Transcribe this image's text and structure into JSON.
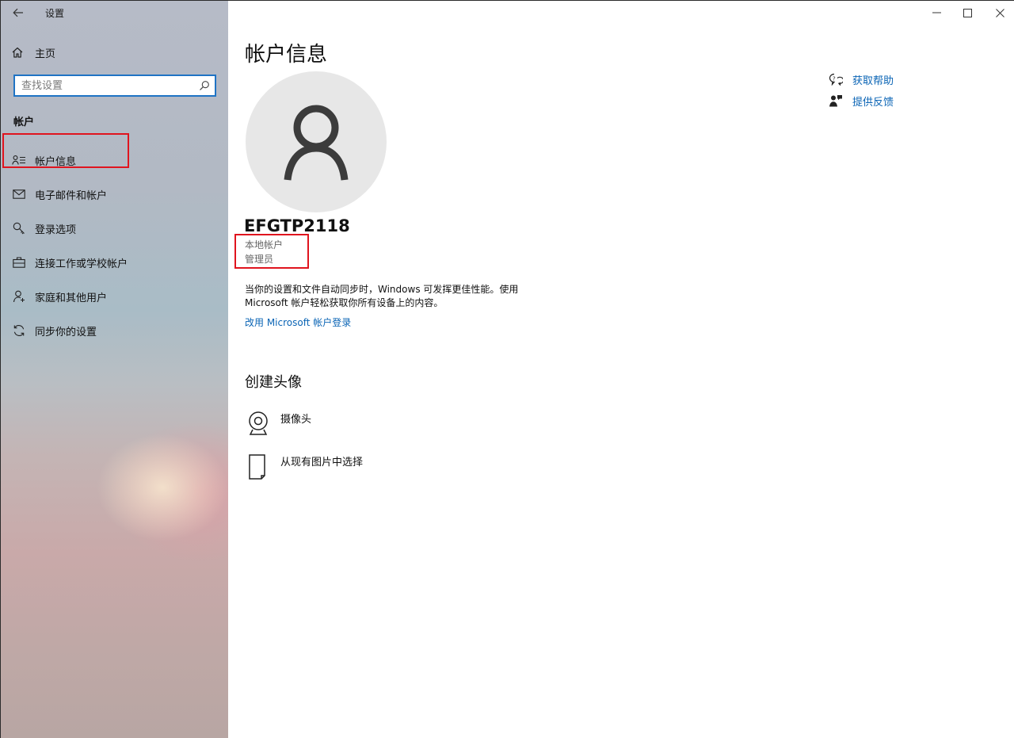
{
  "window": {
    "app_title": "设置",
    "controls": {
      "minimize": "—",
      "maximize": "☐",
      "close": "✕"
    }
  },
  "sidebar": {
    "home_label": "主页",
    "search_placeholder": "查找设置",
    "section_title": "帐户",
    "items": [
      {
        "label": "帐户信息",
        "icon": "account-info-icon"
      },
      {
        "label": "电子邮件和帐户",
        "icon": "mail-icon"
      },
      {
        "label": "登录选项",
        "icon": "key-icon"
      },
      {
        "label": "连接工作或学校帐户",
        "icon": "briefcase-icon"
      },
      {
        "label": "家庭和其他用户",
        "icon": "person-add-icon"
      },
      {
        "label": "同步你的设置",
        "icon": "sync-icon"
      }
    ]
  },
  "main": {
    "title": "帐户信息",
    "username": "EFGTP2118",
    "account_type": "本地帐户",
    "account_role": "管理员",
    "description": "当你的设置和文件自动同步时，Windows 可发挥更佳性能。使用 Microsoft 帐户轻松获取你所有设备上的内容。",
    "ms_login_link": "改用 Microsoft 帐户登录",
    "help_links": [
      {
        "label": "获取帮助",
        "icon": "help-chat-icon"
      },
      {
        "label": "提供反馈",
        "icon": "feedback-icon"
      }
    ],
    "create_avatar_title": "创建头像",
    "avatar_options": [
      {
        "label": "摄像头",
        "icon": "camera-icon"
      },
      {
        "label": "从现有图片中选择",
        "icon": "file-icon"
      }
    ]
  },
  "colors": {
    "accent": "#1f73c4",
    "link": "#0a64b5",
    "highlight_box": "#e0141e"
  }
}
